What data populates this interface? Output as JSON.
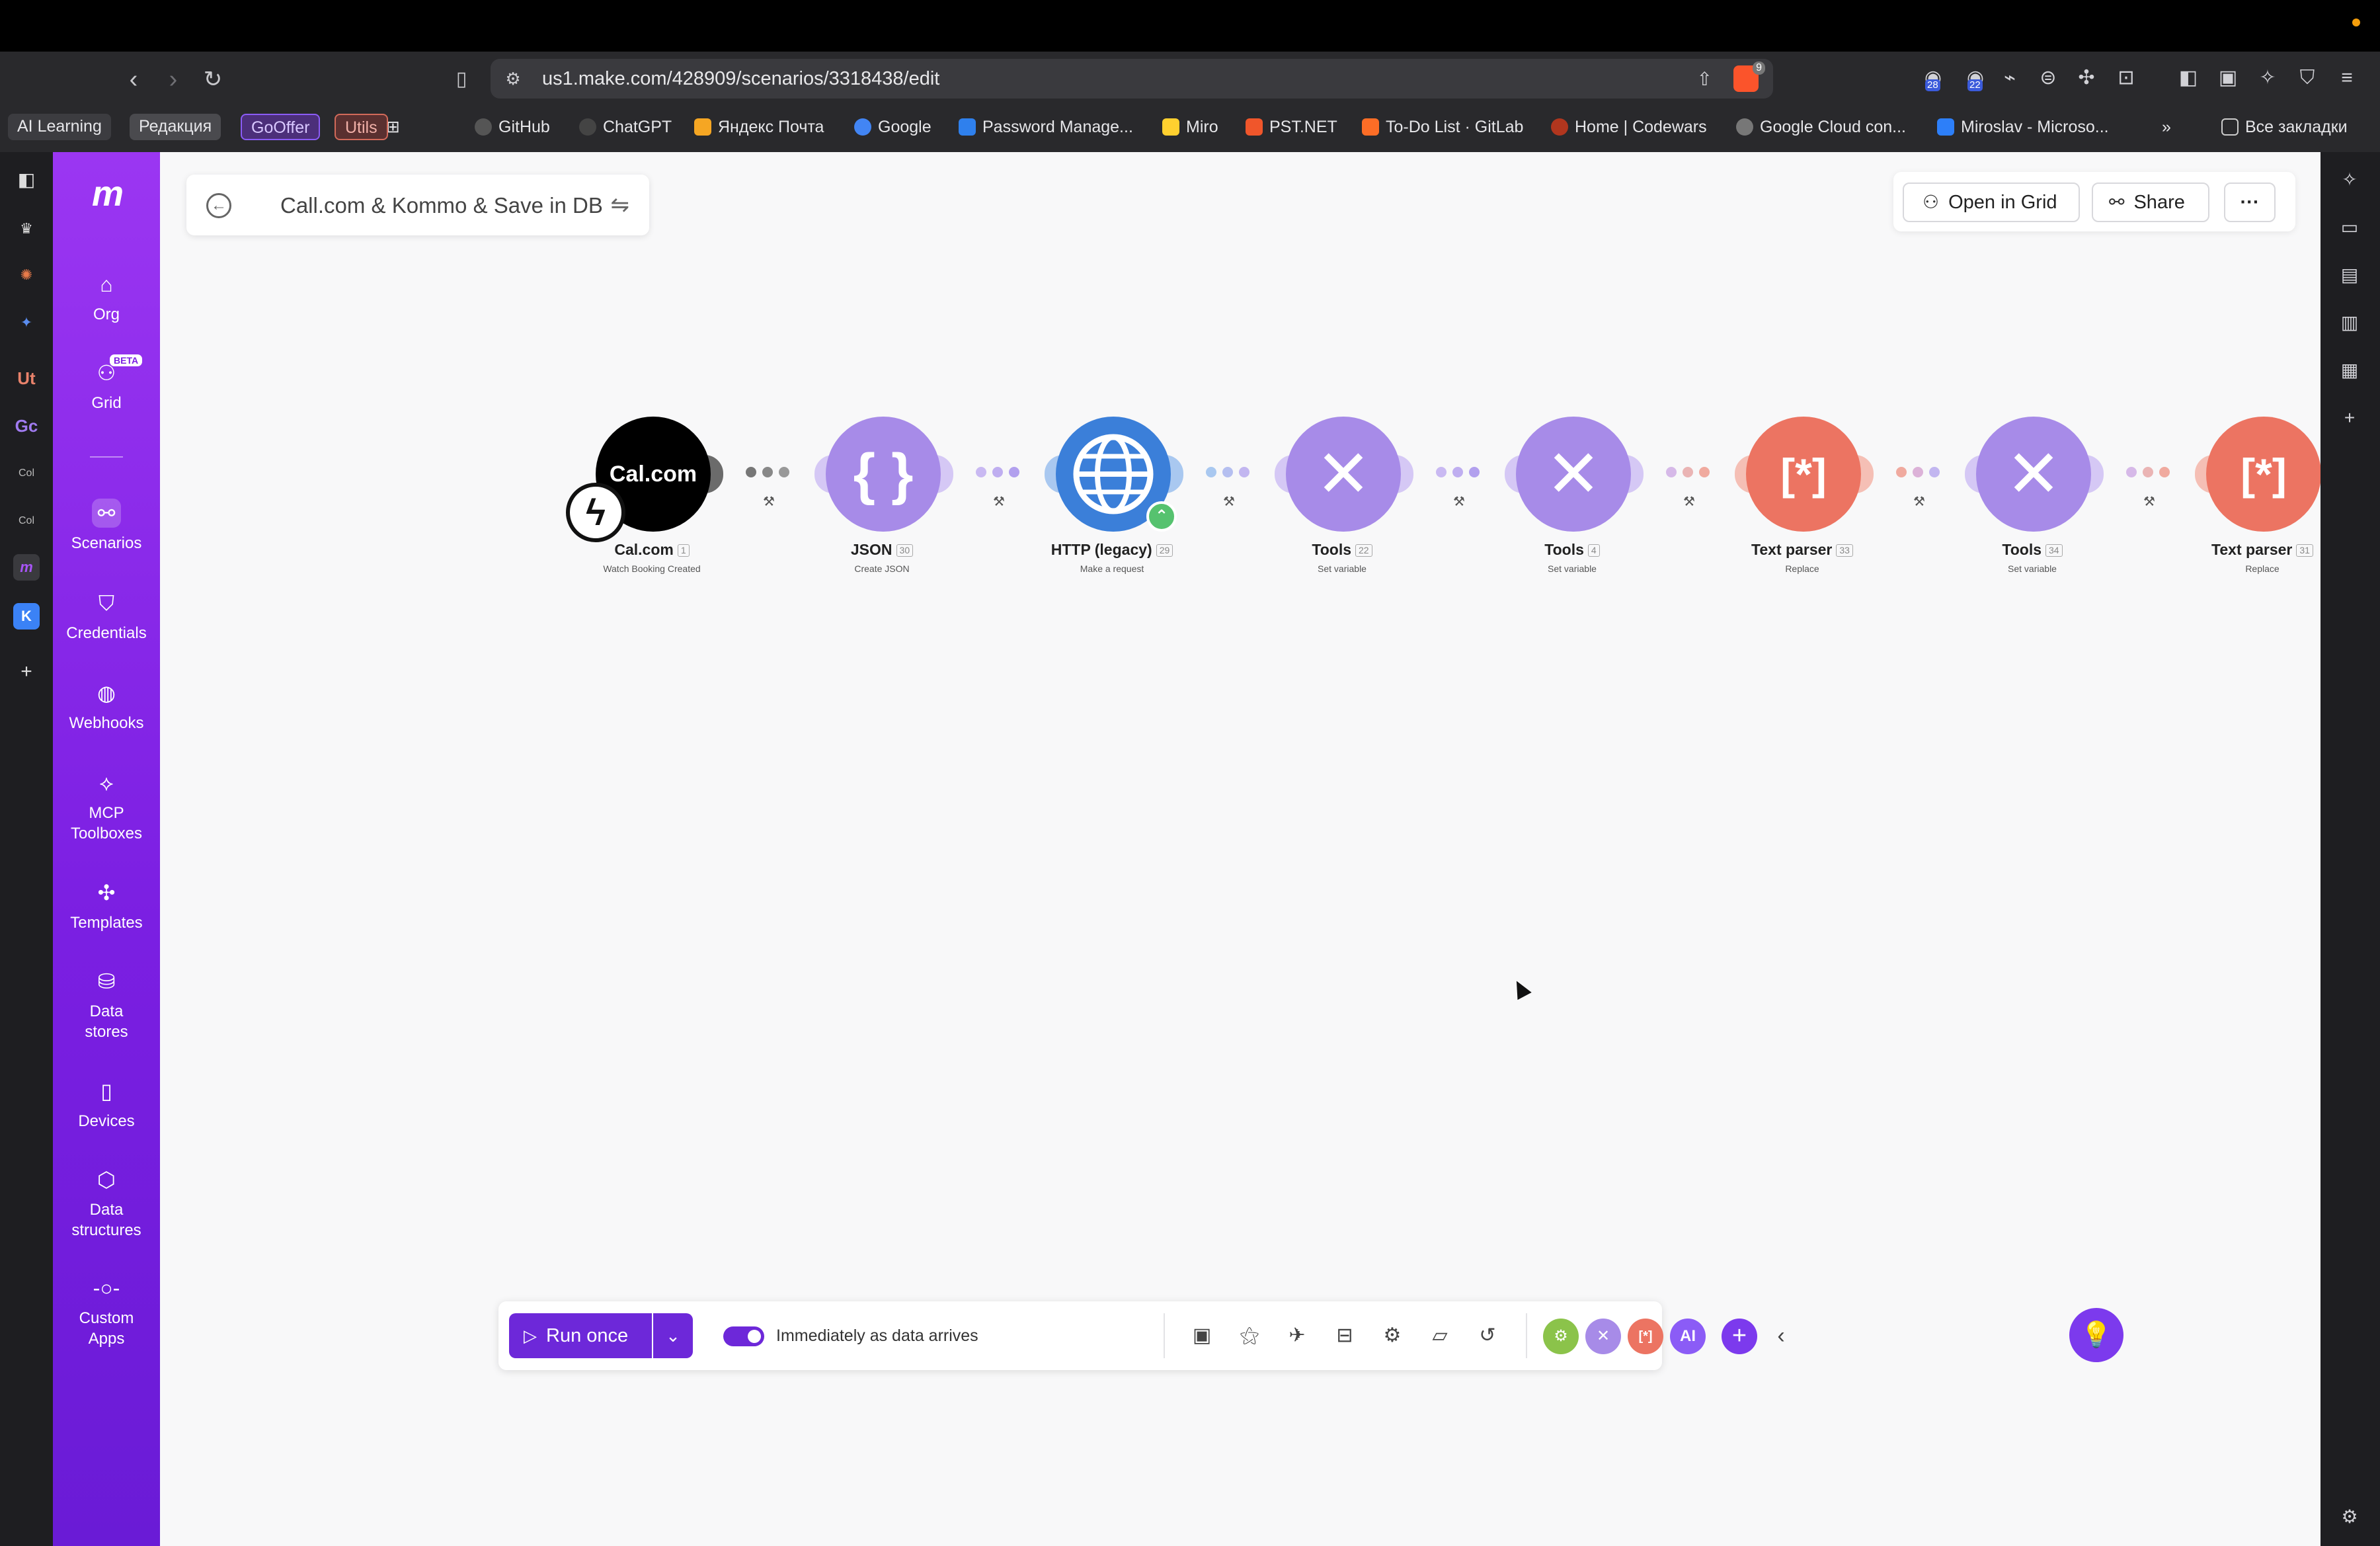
{
  "browser": {
    "url": "us1.make.com/428909/scenarios/3318438/edit",
    "brave_badge": "9",
    "ext_badge_1": "28",
    "ext_badge_2": "22"
  },
  "bookmarks": {
    "chips": [
      "AI Learning",
      "Редакция",
      "GoOffer",
      "Utils"
    ],
    "items": [
      "GitHub",
      "ChatGPT",
      "Яндекс Почта",
      "Google",
      "Password Manage...",
      "Miro",
      "PST.NET",
      "To-Do List · GitLab",
      "Home | Codewars",
      "Google Cloud con...",
      "Miroslav - Microso..."
    ],
    "all_bookmarks": "Все закладки"
  },
  "side_strip": [
    "Ut",
    "Gc",
    "Col",
    "Col"
  ],
  "app_nav": {
    "items": [
      {
        "label": "Org"
      },
      {
        "label": "Grid",
        "badge": "BETA"
      },
      {
        "label": "Scenarios"
      },
      {
        "label": "Credentials"
      },
      {
        "label": "Webhooks"
      },
      {
        "label": "MCP Toolboxes"
      },
      {
        "label": "Templates"
      },
      {
        "label": "Data stores"
      },
      {
        "label": "Devices"
      },
      {
        "label": "Data structures"
      },
      {
        "label": "Custom Apps"
      }
    ]
  },
  "scenario": {
    "title": "Call.com & Kommo & Save in DB",
    "open_in_grid": "Open in Grid",
    "share": "Share",
    "more": "···"
  },
  "modules": [
    {
      "name": "Cal.com",
      "num": "1",
      "sub": "Watch Booking Created",
      "logo_text": "Cal.com",
      "color": "#000000"
    },
    {
      "name": "JSON",
      "num": "30",
      "sub": "Create JSON",
      "glyph": "{ }",
      "color": "#a78be8"
    },
    {
      "name": "HTTP (legacy)",
      "num": "29",
      "sub": "Make a request",
      "color": "#3b7fd9"
    },
    {
      "name": "Tools",
      "num": "22",
      "sub": "Set variable",
      "color": "#a78be8"
    },
    {
      "name": "Tools",
      "num": "4",
      "sub": "Set variable",
      "color": "#a78be8"
    },
    {
      "name": "Text parser",
      "num": "33",
      "sub": "Replace",
      "glyph": "[*]",
      "color": "#ec7462"
    },
    {
      "name": "Tools",
      "num": "34",
      "sub": "Set variable",
      "color": "#a78be8"
    },
    {
      "name": "Text parser",
      "num": "31",
      "sub": "Replace",
      "glyph": "[*]",
      "color": "#ec7462"
    }
  ],
  "toolbar": {
    "run_once": "Run once",
    "schedule": "Immediately as data arrives",
    "ai_label": "AI"
  }
}
